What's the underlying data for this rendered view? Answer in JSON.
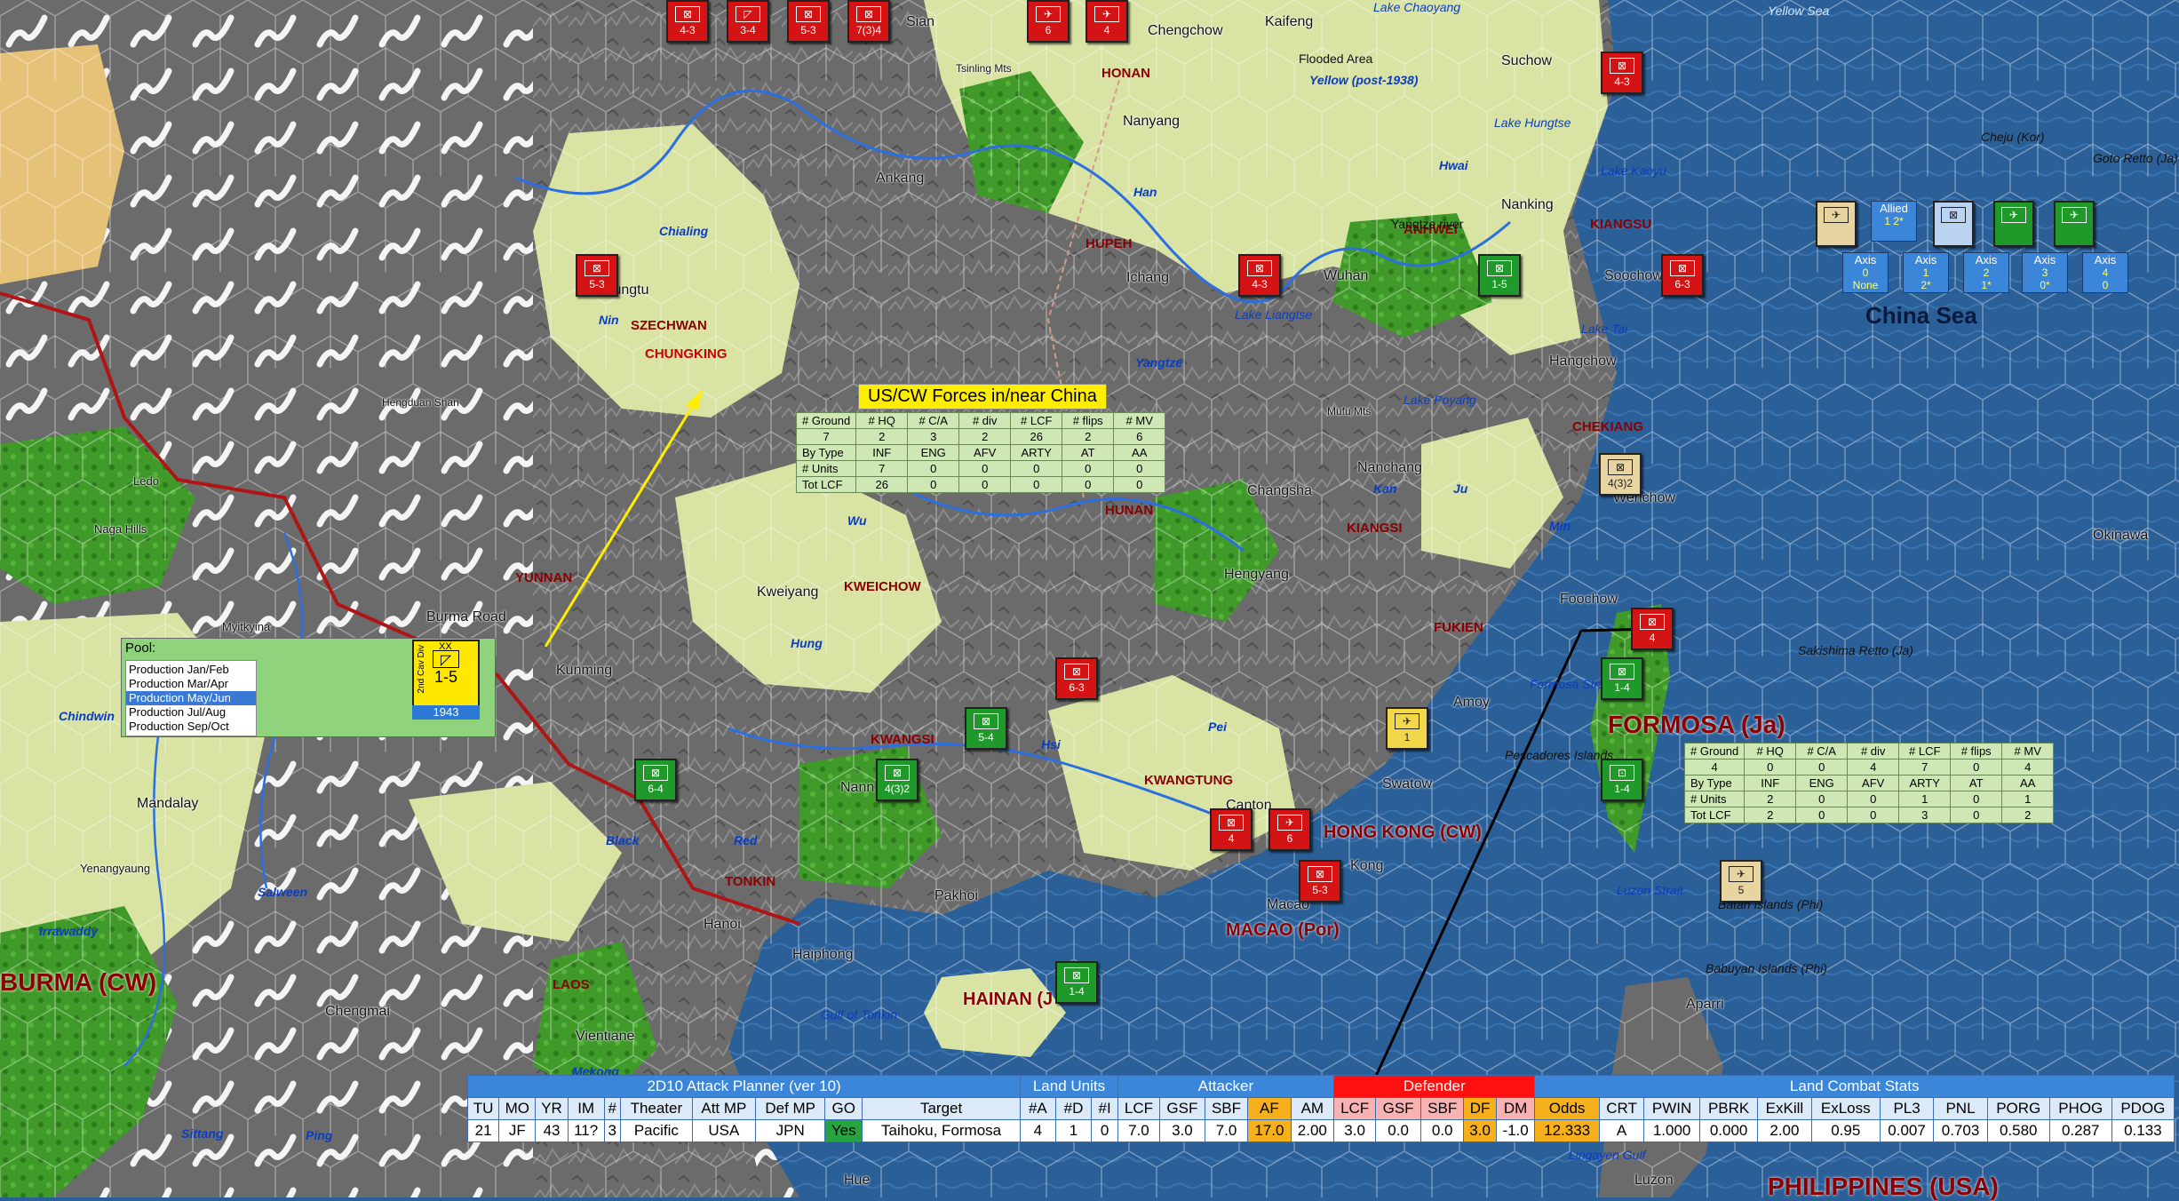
{
  "map": {
    "sea_name": "China Sea",
    "nations": [
      "FORMOSA (Ja)",
      "BURMA (CW)",
      "HONG KONG (CW)",
      "MACAO (Por)",
      "HAINAN (J",
      "PHILIPPINES (USA)"
    ],
    "provinces": [
      "SZECHWAN",
      "CHUNGKING",
      "HUPEH",
      "HONAN",
      "ANHWEI",
      "KIANGSU",
      "CHEKIANG",
      "KIANGSI",
      "HUNAN",
      "KWEICHOW",
      "YUNNAN",
      "FUKIEN",
      "KWANGSI",
      "KWANGTUNG",
      "TONKIN",
      "LAOS"
    ],
    "cities": [
      "Sian",
      "Chengchow",
      "Kaifeng",
      "Suchow",
      "Nanyang",
      "Ankang",
      "Nanking",
      "Wuhan",
      "Ichang",
      "Soochow",
      "Hangchow",
      "Chungtu",
      "Nanchang",
      "Changsha",
      "Hengyang",
      "Kweiyang",
      "Kunming",
      "Burma Road",
      "Myitkyina",
      "Ledo",
      "Naga Hills",
      "Mandalay",
      "Yenangyaung",
      "Chengmai",
      "Vientiane",
      "Hanoi",
      "Haiphong",
      "Pakhoi",
      "Nann",
      "Swatow",
      "Amoy",
      "Foochow",
      "Wenchow",
      "Macao",
      "Kong",
      "Canton",
      "Okinawa",
      "Aparri",
      "Hue",
      "Luzon",
      "Tsinling Mts",
      "Hengduan Shan",
      "Mufu Mts"
    ],
    "rivers": [
      "Yellow (post-1938)",
      "Flooded Area",
      "Han",
      "Hwai",
      "Yangtze",
      "Chialing",
      "Nin",
      "Wu",
      "Hung",
      "Hsi",
      "Pei",
      "Red",
      "Black",
      "Salween",
      "Irrawaddy",
      "Chindwin",
      "Mekong",
      "Ping",
      "Sittang",
      "Kan",
      "Ju",
      "Min",
      "Yangtze river"
    ],
    "waters": [
      "Yellow Sea",
      "Lake Chaoyang",
      "Lake Hungtse",
      "Lake Kaoyu",
      "Lake Liangtse",
      "Lake Tai",
      "Lake Poyang",
      "Gulf of Tonkin",
      "Luzon Strait",
      "Formosa Strait",
      "Pescadores Islands",
      "Sakishima Retto (Ja)",
      "Cheju (Kor)",
      "Goto Retto (Ja)",
      "Babuyan Islands (Phi)",
      "Batan Islands (Phi)",
      "Lingayen Gulf"
    ]
  },
  "counters": [
    {
      "label": "4-3",
      "color": "red"
    },
    {
      "label": "3-4",
      "color": "red"
    },
    {
      "label": "5-3",
      "color": "red"
    },
    {
      "label": "7(3)4",
      "color": "red"
    },
    {
      "label": "6",
      "color": "red"
    },
    {
      "label": "4",
      "color": "red"
    },
    {
      "label": "4-3",
      "color": "red"
    },
    {
      "label": "5-3",
      "color": "red"
    },
    {
      "label": "4-3",
      "color": "red"
    },
    {
      "label": "6-3",
      "color": "red"
    },
    {
      "label": "1-5",
      "color": "green"
    },
    {
      "label": "4(3)2",
      "color": "tan"
    },
    {
      "label": "6-3",
      "color": "red"
    },
    {
      "label": "5-4",
      "color": "green"
    },
    {
      "label": "6-4",
      "color": "green"
    },
    {
      "label": "4(3)2",
      "color": "green"
    },
    {
      "label": "4",
      "color": "red"
    },
    {
      "label": "6",
      "color": "red"
    },
    {
      "label": "5-3",
      "color": "red"
    },
    {
      "label": "1-4",
      "color": "green"
    },
    {
      "label": "4",
      "color": "red"
    },
    {
      "label": "1-4",
      "color": "green"
    },
    {
      "label": "1-4",
      "color": "green"
    },
    {
      "label": "1",
      "color": "yellow"
    },
    {
      "label": "5",
      "color": "tan"
    }
  ],
  "china_forces": {
    "title": "US/CW Forces in/near China",
    "headers": [
      "# Ground",
      "# HQ",
      "# C/A",
      "# div",
      "# LCF",
      "# flips",
      "# MV"
    ],
    "counts": [
      "7",
      "2",
      "3",
      "2",
      "26",
      "2",
      "6"
    ],
    "by_type": [
      "By Type",
      "INF",
      "ENG",
      "AFV",
      "ARTY",
      "AT",
      "AA"
    ],
    "units": [
      "# Units",
      "7",
      "0",
      "0",
      "0",
      "0",
      "0"
    ],
    "tot_lcf": [
      "Tot LCF",
      "26",
      "0",
      "0",
      "0",
      "0",
      "0"
    ]
  },
  "formosa_forces": {
    "headers": [
      "# Ground",
      "# HQ",
      "# C/A",
      "# div",
      "# LCF",
      "# flips",
      "# MV"
    ],
    "counts": [
      "4",
      "0",
      "0",
      "4",
      "7",
      "0",
      "4"
    ],
    "by_type": [
      "By Type",
      "INF",
      "ENG",
      "AFV",
      "ARTY",
      "AT",
      "AA"
    ],
    "units": [
      "# Units",
      "2",
      "0",
      "0",
      "1",
      "0",
      "1"
    ],
    "tot_lcf": [
      "Tot LCF",
      "2",
      "0",
      "0",
      "3",
      "0",
      "2"
    ]
  },
  "pool": {
    "label": "Pool:",
    "items": [
      "Production Jan/Feb",
      "Production Mar/Apr",
      "Production May/Jun",
      "Production Jul/Aug",
      "Production Sep/Oct"
    ],
    "selected_index": 2,
    "card": {
      "side": "2nd Cav Div",
      "size": "XX",
      "value": "1-5",
      "year": "1943"
    }
  },
  "axis_stacks": [
    {
      "top": "Axis",
      "val": "0",
      "sub": "None"
    },
    {
      "top": "Axis",
      "val": "1",
      "sub": "2*"
    },
    {
      "top": "Axis",
      "val": "2",
      "sub": "1*"
    },
    {
      "top": "Axis",
      "val": "3",
      "sub": "0*"
    },
    {
      "top": "Axis",
      "val": "4",
      "sub": "0"
    }
  ],
  "allied_stack": {
    "top": "Allied",
    "val": "1",
    "sub": "2*"
  },
  "planner": {
    "title": "2D10 Attack Planner (ver 10)",
    "group_land_units": "Land Units",
    "group_attacker": "Attacker",
    "group_defender": "Defender",
    "group_stats": "Land Combat Stats",
    "headers": [
      "TU",
      "MO",
      "YR",
      "IM",
      "#",
      "Theater",
      "Att MP",
      "Def MP",
      "GO",
      "Target",
      "#A",
      "#D",
      "#I",
      "LCF",
      "GSF",
      "SBF",
      "AF",
      "AM",
      "LCF",
      "GSF",
      "SBF",
      "DF",
      "DM",
      "Odds",
      "CRT",
      "PWIN",
      "PBRK",
      "ExKill",
      "ExLoss",
      "PL3",
      "PNL",
      "PORG",
      "PHOG",
      "PDOG"
    ],
    "values": [
      "21",
      "JF",
      "43",
      "11?",
      "3",
      "Pacific",
      "USA",
      "JPN",
      "Yes",
      "Taihoku, Formosa",
      "4",
      "1",
      "0",
      "7.0",
      "3.0",
      "7.0",
      "17.0",
      "2.00",
      "3.0",
      "0.0",
      "0.0",
      "3.0",
      "-1.0",
      "12.333",
      "A",
      "1.000",
      "0.000",
      "2.00",
      "0.95",
      "0.007",
      "0.703",
      "0.580",
      "0.287",
      "0.133"
    ]
  },
  "colors": {
    "sea": "#2a5f97",
    "mountain": "#6f6f6f",
    "plains": "#d8e3a4",
    "forest": "#3f9a2a",
    "desert": "#e6c278",
    "allied_green": "#1f9a2a",
    "axis_red": "#d41414"
  }
}
